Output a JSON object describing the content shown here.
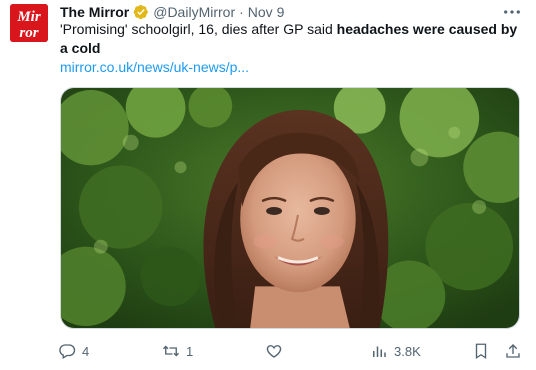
{
  "tweet": {
    "author_name": "The Mirror",
    "handle": "@DailyMirror",
    "separator": "·",
    "date": "Nov 9",
    "avatar_text": "Mirror",
    "text_plain": "'Promising' schoolgirl, 16, dies after GP said ",
    "text_bold": "headaches were caused by a cold",
    "link": "mirror.co.uk/news/uk-news/p...",
    "media_alt": "Photo of a smiling teenage girl with brown hair in front of green foliage"
  },
  "actions": {
    "replies": "4",
    "reposts": "1",
    "likes": "",
    "views": "3.8K"
  },
  "colors": {
    "brand_red": "#d9161c",
    "verified_gold": "#e2b719",
    "link_blue": "#1d9bf0",
    "muted": "#536471"
  },
  "icons": [
    "verified-badge-icon",
    "more-icon",
    "reply-icon",
    "repost-icon",
    "like-icon",
    "views-icon",
    "bookmark-icon",
    "share-icon"
  ]
}
